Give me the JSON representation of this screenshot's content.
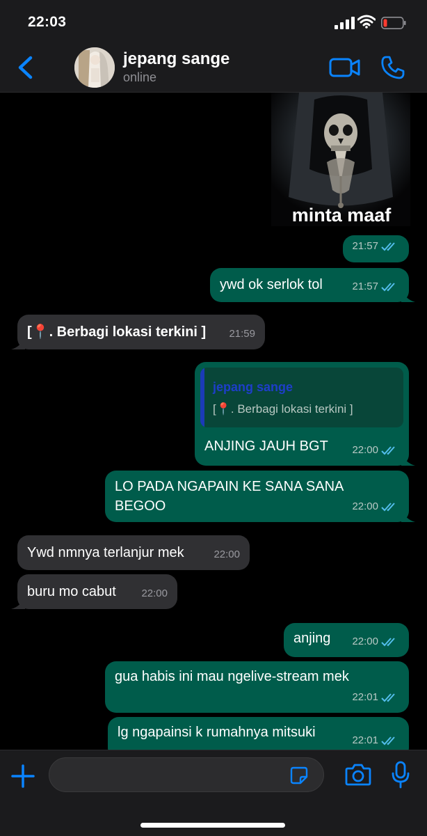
{
  "status_bar": {
    "time": "22:03"
  },
  "header": {
    "contact_name": "jepang sange",
    "contact_status": "online"
  },
  "sticker": {
    "caption": "minta maaf"
  },
  "messages": [
    {
      "dir": "out",
      "text": "",
      "time": "21:57",
      "ticks": "read"
    },
    {
      "dir": "out",
      "text": "ywd ok serlok tol",
      "time": "21:57",
      "ticks": "read"
    },
    {
      "dir": "in",
      "text": "[📍. Berbagi lokasi terkini ]",
      "time": "21:59"
    },
    {
      "dir": "out",
      "quote_name": "jepang sange",
      "quote_text": "[📍. Berbagi lokasi terkini ]",
      "text": "ANJING JAUH BGT",
      "time": "22:00",
      "ticks": "read"
    },
    {
      "dir": "out",
      "text_line1": "LO PADA NGAPAIN KE SANA SANA",
      "text_line2": "BEGOO",
      "time": "22:00",
      "ticks": "read"
    },
    {
      "dir": "in",
      "text": "Ywd nmnya terlanjur mek",
      "time": "22:00"
    },
    {
      "dir": "in",
      "text": "buru mo cabut",
      "time": "22:00"
    },
    {
      "dir": "out",
      "text": "anjing",
      "time": "22:00",
      "ticks": "read"
    },
    {
      "dir": "out",
      "text": "gua habis ini mau ngelive-stream mek",
      "time": "22:01",
      "ticks": "read"
    },
    {
      "dir": "out",
      "text": "lg ngapainsi k rumahnya mitsuki",
      "time": "22:01",
      "ticks": "read"
    }
  ],
  "input": {
    "placeholder": ""
  },
  "icons": {
    "back": "chevron-left-icon",
    "video": "video-camera-icon",
    "call": "phone-icon",
    "plus": "plus-icon",
    "sticker": "sticker-icon",
    "camera": "camera-icon",
    "mic": "microphone-icon"
  },
  "colors": {
    "accent": "#0a84ff",
    "outgoing_bubble": "#005c4b",
    "incoming_bubble": "#303033",
    "read_ticks": "#53bdeb",
    "quote_name": "#1e3ec9"
  }
}
